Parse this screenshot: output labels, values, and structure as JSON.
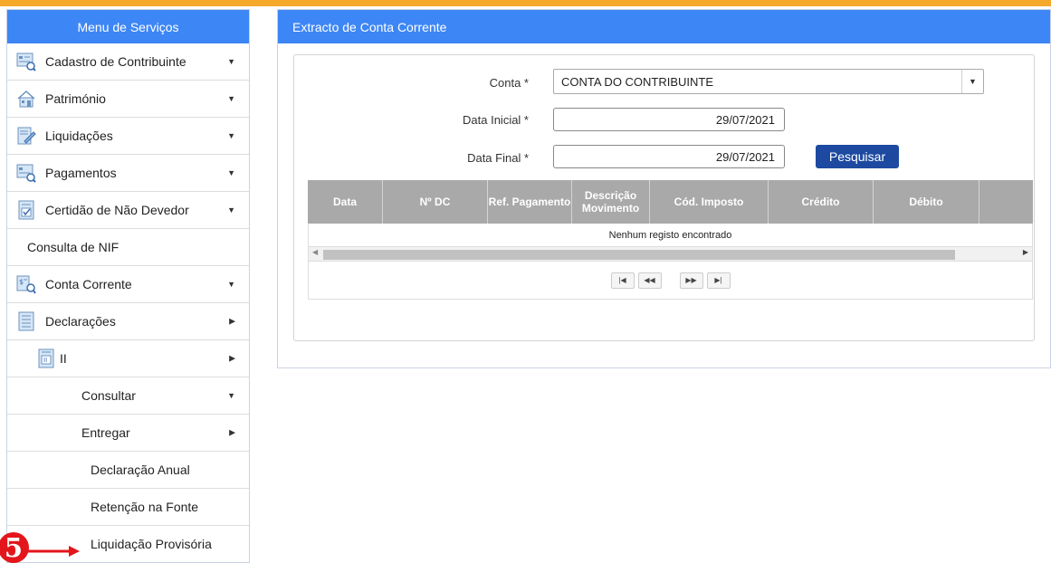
{
  "sidebar": {
    "title": "Menu de Serviços",
    "items": [
      {
        "label": "Cadastro de Contribuinte",
        "icon": "register-icon",
        "arrow": "▼"
      },
      {
        "label": "Património",
        "icon": "house-icon",
        "arrow": "▼"
      },
      {
        "label": "Liquidações",
        "icon": "document-pen-icon",
        "arrow": "▼"
      },
      {
        "label": "Pagamentos",
        "icon": "payment-form-icon",
        "arrow": "▼"
      },
      {
        "label": "Certidão de Não Devedor",
        "icon": "certificate-icon",
        "arrow": "▼"
      },
      {
        "label": "Consulta de NIF"
      },
      {
        "label": "Conta Corrente",
        "icon": "account-search-icon",
        "arrow": "▼"
      },
      {
        "label": "Declarações",
        "icon": "declaration-icon",
        "arrow": "▶"
      },
      {
        "label": "II",
        "icon": "tax-form-icon",
        "arrow": "▶"
      },
      {
        "label": "Consultar",
        "arrow": "▼"
      },
      {
        "label": "Entregar",
        "arrow": "▶"
      },
      {
        "label": "Declaração Anual"
      },
      {
        "label": "Retenção na Fonte"
      },
      {
        "label": "Liquidação Provisória"
      }
    ]
  },
  "annotation": {
    "step": "5",
    "color": "#e3161b"
  },
  "main": {
    "title": "Extracto de Conta Corrente",
    "form": {
      "conta_label": "Conta *",
      "conta_value": "CONTA DO CONTRIBUINTE",
      "data_inicial_label": "Data Inicial *",
      "data_inicial_value": "29/07/2021",
      "data_final_label": "Data Final *",
      "data_final_value": "29/07/2021",
      "search_button": "Pesquisar"
    },
    "table": {
      "columns": [
        "Data",
        "Nº DC",
        "Ref. Pagamento",
        "Descrição Movimento",
        "Cód. Imposto",
        "Crédito",
        "Débito"
      ],
      "empty_message": "Nenhum registo encontrado"
    },
    "paginator": {
      "first": "|◀",
      "prev": "◀◀",
      "next": "▶▶",
      "last": "▶|"
    }
  },
  "colors": {
    "header_blue": "#3d86f5",
    "button_navy": "#1d4aa0",
    "table_header": "#a9a9a9",
    "top_accent": "#f4a92b"
  }
}
